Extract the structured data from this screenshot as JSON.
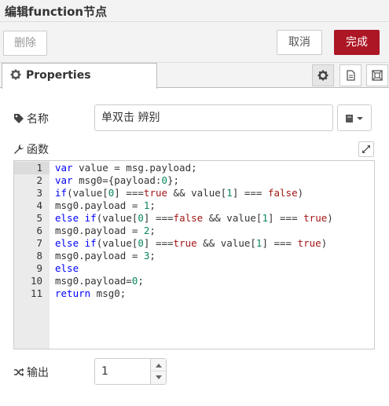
{
  "dialog": {
    "title": "编辑function节点"
  },
  "toolbar": {
    "delete_label": "删除",
    "cancel_label": "取消",
    "done_label": "完成"
  },
  "colors": {
    "primary": "#ad1625",
    "keyword": "#0000ff",
    "number": "#09885a",
    "boolean": "#a31515"
  },
  "tabs": {
    "properties_label": "Properties",
    "icons": [
      "gear-icon",
      "description-icon",
      "appearance-icon"
    ]
  },
  "form": {
    "name_label": "名称",
    "name_value": "单双击 辨别",
    "function_label": "函数",
    "outputs_label": "输出",
    "outputs_value": "1"
  },
  "editor": {
    "lines": [
      {
        "n": "1",
        "tokens": [
          [
            "kw",
            "var"
          ],
          [
            "t",
            " value = msg.payload;"
          ]
        ]
      },
      {
        "n": "2",
        "tokens": [
          [
            "kw",
            "var"
          ],
          [
            "t",
            " msg0={payload:"
          ],
          [
            "num",
            "0"
          ],
          [
            "t",
            "};"
          ]
        ]
      },
      {
        "n": "3",
        "tokens": [
          [
            "kw",
            "if"
          ],
          [
            "t",
            "(value["
          ],
          [
            "num",
            "0"
          ],
          [
            "t",
            "] ==="
          ],
          [
            "bool",
            "true"
          ],
          [
            "t",
            " && value["
          ],
          [
            "num",
            "1"
          ],
          [
            "t",
            "] === "
          ],
          [
            "bool",
            "false"
          ],
          [
            "t",
            ")"
          ]
        ]
      },
      {
        "n": "4",
        "tokens": [
          [
            "t",
            "msg0.payload = "
          ],
          [
            "num",
            "1"
          ],
          [
            "t",
            ";"
          ]
        ]
      },
      {
        "n": "5",
        "tokens": [
          [
            "kw",
            "else if"
          ],
          [
            "t",
            "(value["
          ],
          [
            "num",
            "0"
          ],
          [
            "t",
            "] ==="
          ],
          [
            "bool",
            "false"
          ],
          [
            "t",
            " && value["
          ],
          [
            "num",
            "1"
          ],
          [
            "t",
            "] === "
          ],
          [
            "bool",
            "true"
          ],
          [
            "t",
            ")"
          ]
        ]
      },
      {
        "n": "6",
        "tokens": [
          [
            "t",
            "msg0.payload = "
          ],
          [
            "num",
            "2"
          ],
          [
            "t",
            ";"
          ]
        ]
      },
      {
        "n": "7",
        "tokens": [
          [
            "kw",
            "else if"
          ],
          [
            "t",
            "(value["
          ],
          [
            "num",
            "0"
          ],
          [
            "t",
            "] ==="
          ],
          [
            "bool",
            "true"
          ],
          [
            "t",
            " && value["
          ],
          [
            "num",
            "1"
          ],
          [
            "t",
            "] === "
          ],
          [
            "bool",
            "true"
          ],
          [
            "t",
            ")"
          ]
        ]
      },
      {
        "n": "8",
        "tokens": [
          [
            "t",
            "msg0.payload = "
          ],
          [
            "num",
            "3"
          ],
          [
            "t",
            ";"
          ]
        ]
      },
      {
        "n": "9",
        "tokens": [
          [
            "kw",
            "else"
          ]
        ]
      },
      {
        "n": "10",
        "tokens": [
          [
            "t",
            "msg0.payload="
          ],
          [
            "num",
            "0"
          ],
          [
            "t",
            ";"
          ]
        ]
      },
      {
        "n": "11",
        "tokens": [
          [
            "kw",
            "return"
          ],
          [
            "t",
            " msg0;"
          ]
        ]
      }
    ]
  }
}
